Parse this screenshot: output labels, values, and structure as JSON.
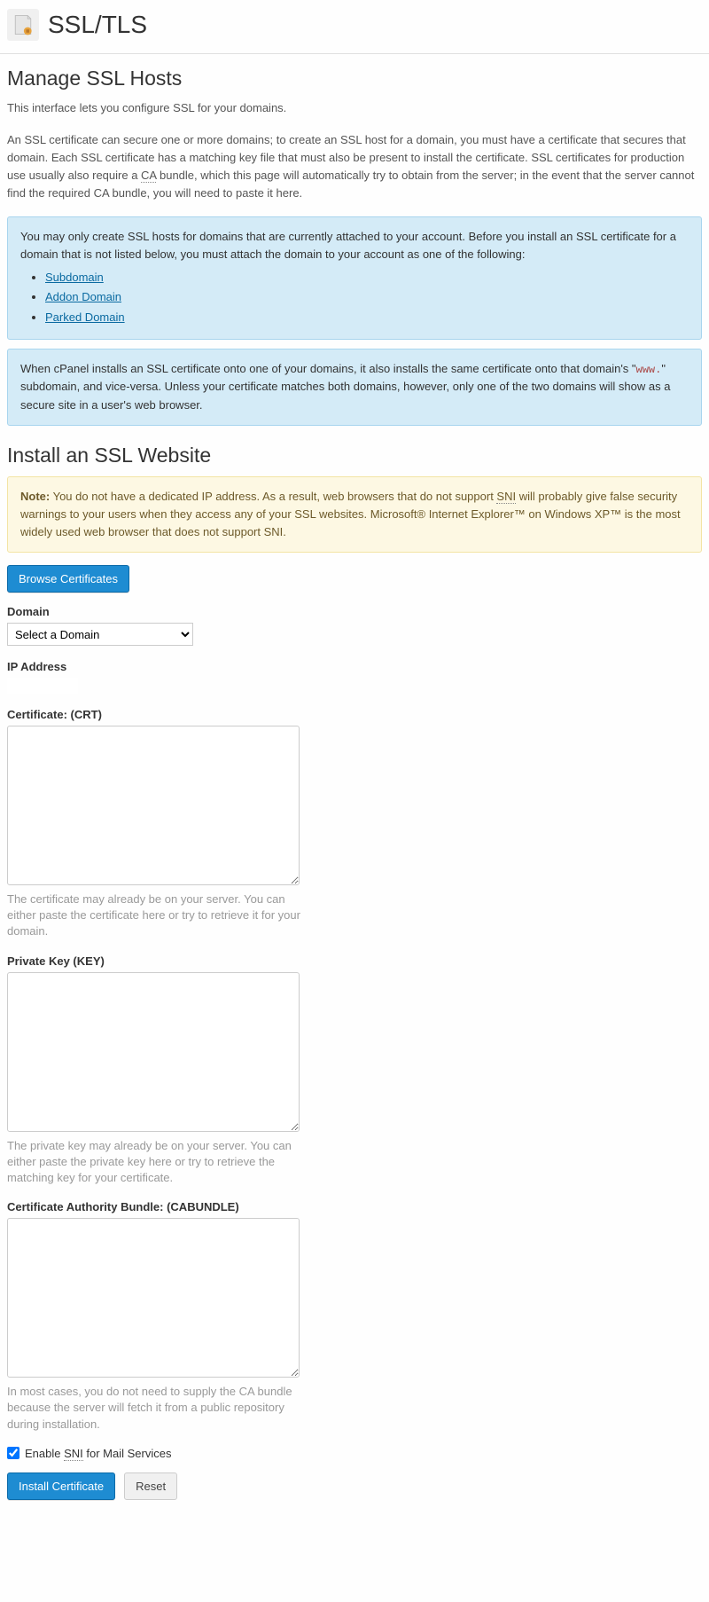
{
  "header": {
    "title": "SSL/TLS"
  },
  "section1": {
    "heading": "Manage SSL Hosts",
    "intro": "This interface lets you configure SSL for your domains.",
    "para_a": "An SSL certificate can secure one or more domains; to create an SSL host for a domain, you must have a certificate that secures that domain. Each SSL certificate has a matching key file that must also be present to install the certificate. SSL certificates for production use usually also require a ",
    "ca_abbr": "CA",
    "para_b": " bundle, which this page will automatically try to obtain from the server; in the event that the server cannot find the required CA bundle, you will need to paste it here."
  },
  "info1": {
    "text": "You may only create SSL hosts for domains that are currently attached to your account. Before you install an SSL certificate for a domain that is not listed below, you must attach the domain to your account as one of the following:",
    "links": [
      "Subdomain",
      "Addon Domain",
      "Parked Domain"
    ]
  },
  "info2": {
    "a": "When cPanel installs an SSL certificate onto one of your domains, it also installs the same certificate onto that domain's \"",
    "www": "www.",
    "b": "\" subdomain, and vice-versa. Unless your certificate matches both domains, however, only one of the two domains will show as a secure site in a user's web browser."
  },
  "section2": {
    "heading": "Install an SSL Website",
    "note_label": "Note:",
    "note_a": " You do not have a dedicated IP address. As a result, web browsers that do not support ",
    "sni1": "SNI",
    "note_b": " will probably give false security warnings to your users when they access any of your SSL websites. Microsoft® Internet Explorer™ on Windows XP™ is the most widely used web browser that does not support SNI."
  },
  "buttons": {
    "browse": "Browse Certificates",
    "install": "Install Certificate",
    "reset": "Reset"
  },
  "form": {
    "domain_label": "Domain",
    "domain_placeholder": "Select a Domain",
    "ip_label": "IP Address",
    "crt_label": "Certificate: (CRT)",
    "crt_help": "The certificate may already be on your server. You can either paste the certificate here or try to retrieve it for your domain.",
    "key_label": "Private Key (KEY)",
    "key_help": "The private key may already be on your server. You can either paste the private key here or try to retrieve the matching key for your certificate.",
    "cab_label": "Certificate Authority Bundle: (CABUNDLE)",
    "cab_help": "In most cases, you do not need to supply the CA bundle because the server will fetch it from a public repository during installation.",
    "sni_checkbox_a": "Enable ",
    "sni_abbr": "SNI",
    "sni_checkbox_b": " for Mail Services"
  }
}
